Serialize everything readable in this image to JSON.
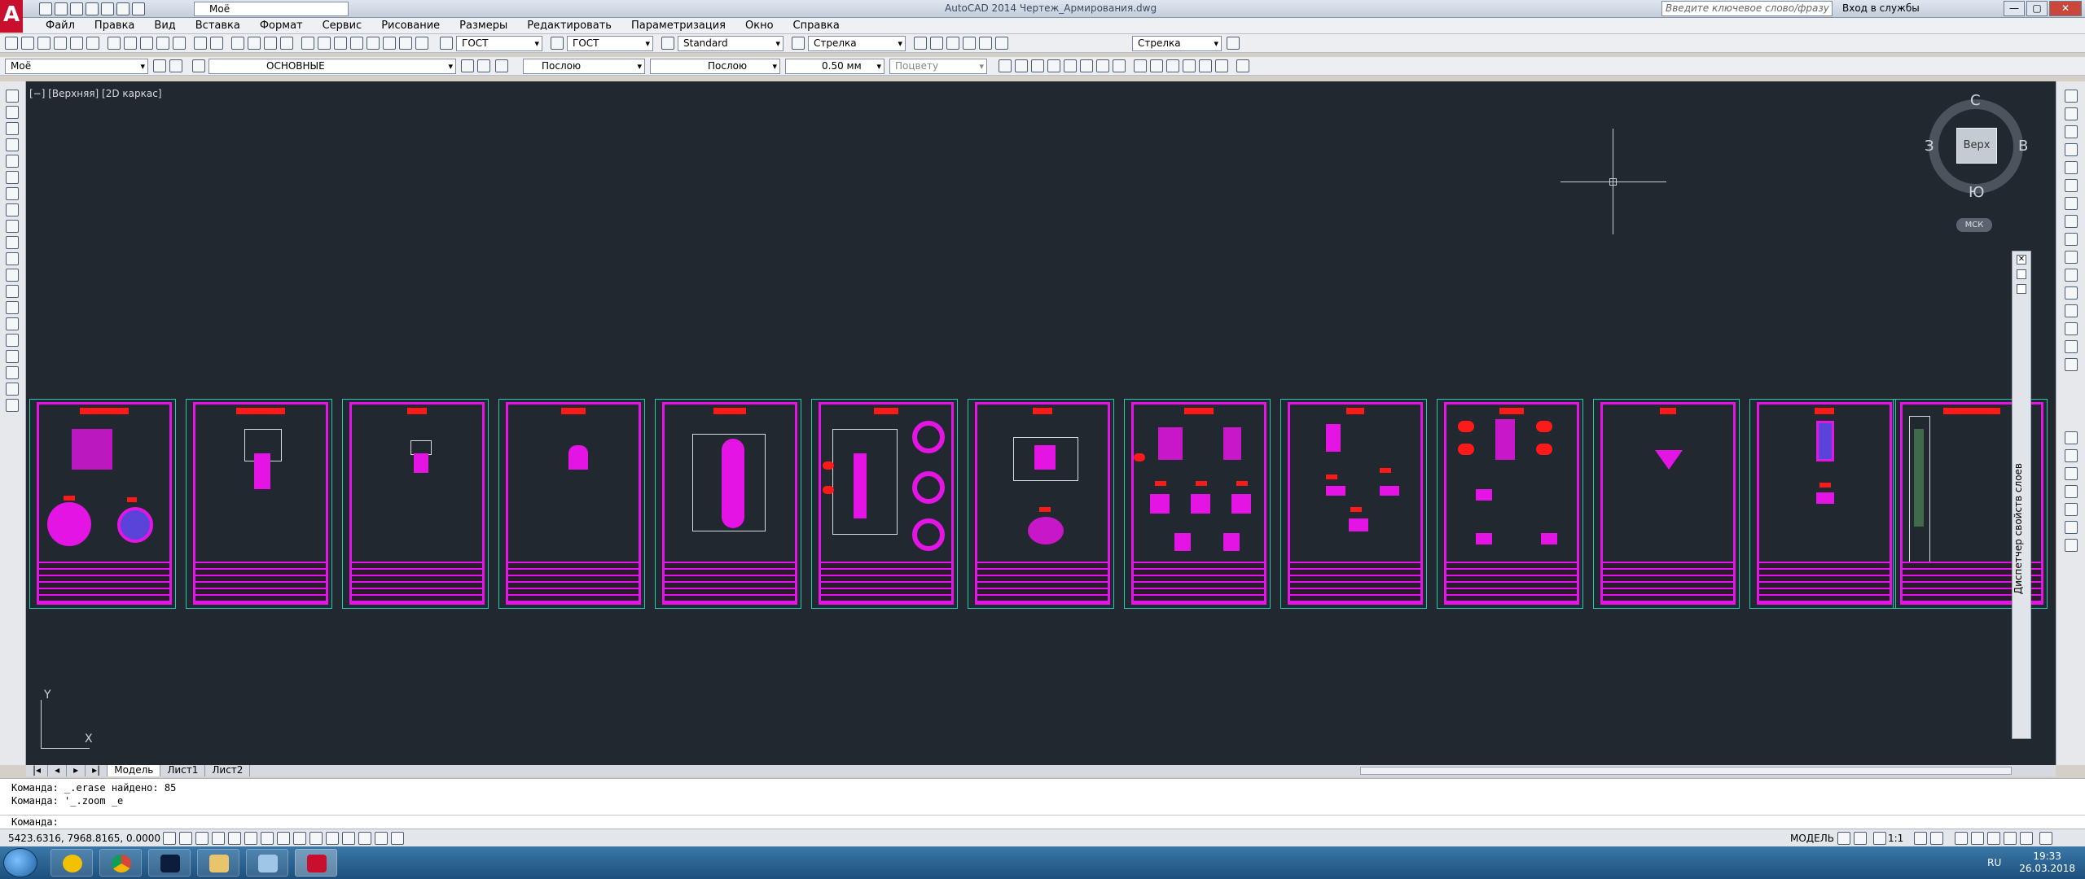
{
  "titlebar": {
    "workspace": "Моё",
    "title": "AutoCAD 2014  Чертеж_Армирования.dwg",
    "search_placeholder": "Введите ключевое слово/фразу",
    "login": "Вход в службы",
    "min": "—",
    "max": "▢",
    "close": "✕"
  },
  "menu": [
    "Файл",
    "Правка",
    "Вид",
    "Вставка",
    "Формат",
    "Сервис",
    "Рисование",
    "Размеры",
    "Редактировать",
    "Параметризация",
    "Окно",
    "Справка"
  ],
  "toolbar1": {
    "text_style": "ГОСТ",
    "dim_style": "ГОСТ",
    "table_style": "Standard",
    "mleader_style": "Стрелка",
    "mleader_style2": "Стрелка"
  },
  "toolbar2": {
    "workspace": "Моё",
    "layer": "ОСНОВНЫЕ",
    "color": "Послою",
    "linetype": "Послою",
    "lineweight": "0.50 мм",
    "plotstyle": "Поцвету"
  },
  "viewport": {
    "label": "[−] [Верхняя] [2D каркас]"
  },
  "viewcube": {
    "face": "Верх",
    "north": "С",
    "south": "Ю",
    "west": "З",
    "east": "В",
    "wcs": "МСК"
  },
  "ucs": {
    "x": "X",
    "y": "Y"
  },
  "palette": {
    "title": "Диспетчер свойств слоев",
    "close": "✕"
  },
  "tabs": [
    "Модель",
    "Лист1",
    "Лист2"
  ],
  "command": {
    "history": [
      "Команда: _.erase найдено: 85",
      "Команда: '_.zoom _e"
    ],
    "prompt": "Команда:"
  },
  "status": {
    "coords": "5423.6316, 7968.8165, 0.0000",
    "model": "МОДЕЛЬ",
    "scale": "1:1"
  },
  "taskbar": {
    "lang": "RU",
    "time": "19:33",
    "date": "26.03.2018"
  },
  "colors": {
    "canvas": "#212830",
    "sheet_frame": "#e414e4",
    "sheet_border": "#23c8b4",
    "title_mark": "#ff1a1a"
  }
}
